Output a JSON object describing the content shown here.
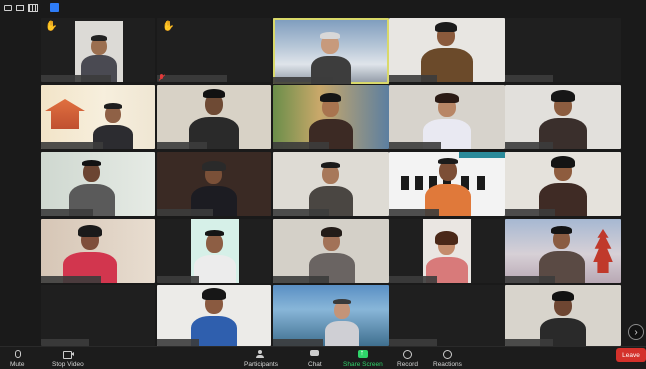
{
  "toolbar": {
    "mute_label": "Mute",
    "stop_video_label": "Stop Video",
    "participants_label": "Participants",
    "chat_label": "Chat",
    "share_screen_label": "Share Screen",
    "record_label": "Record",
    "reactions_label": "Reactions",
    "leave_label": "Leave"
  },
  "icons": {
    "view_controls": [
      "speaker-view-icon",
      "minimize-icon",
      "gallery-view-icon",
      "fullscreen-icon"
    ],
    "raised_hand": "raised-hand-icon",
    "muted": "mic-muted-icon",
    "next_page": "chevron-right-icon"
  },
  "colors": {
    "background": "#1a1a1a",
    "active_speaker_border": "#d9d96a",
    "leave_button": "#d4312b",
    "share_screen": "#2fd46a",
    "raised_hand": "#f5c542",
    "muted_mic": "#e03a3a"
  },
  "next_page_glyph": "›"
}
